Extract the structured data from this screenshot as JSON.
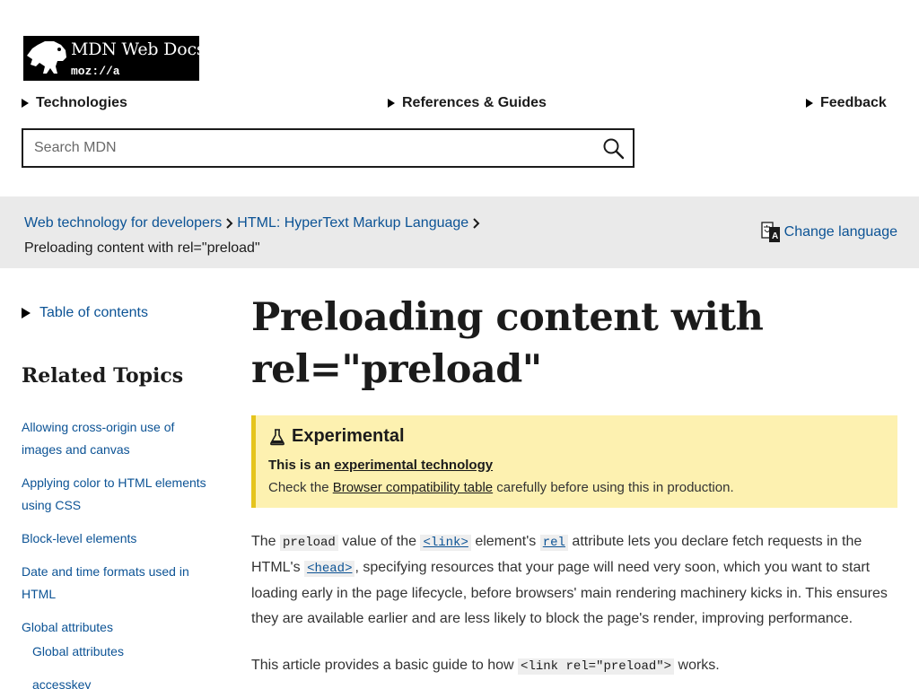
{
  "logo": {
    "title": "MDN Web Docs",
    "sub": "moz://a"
  },
  "nav": {
    "technologies": "Technologies",
    "references": "References & Guides",
    "feedback": "Feedback"
  },
  "search": {
    "placeholder": "Search MDN"
  },
  "breadcrumbs": {
    "items": [
      "Web technology for developers",
      "HTML: HyperText Markup Language"
    ],
    "current": "Preloading content with rel=\"preload\""
  },
  "language": {
    "label": "Change language"
  },
  "sidebar": {
    "toc": "Table of contents",
    "related": "Related Topics",
    "links": [
      "Allowing cross-origin use of images and canvas",
      "Applying color to HTML elements using CSS",
      "Block-level elements",
      "Date and time formats used in HTML",
      "Global attributes"
    ],
    "sub_links": [
      "Global attributes",
      "accesskey"
    ]
  },
  "article": {
    "title": "Preloading content with rel=\"preload\"",
    "notice": {
      "heading": "Experimental",
      "line1_prefix": "This is an ",
      "line1_link": "experimental technology",
      "line2_prefix": "Check the ",
      "line2_link": "Browser compatibility table",
      "line2_suffix": " carefully before using this in production."
    },
    "p1": {
      "t1": "The ",
      "c1": "preload",
      "t2": " value of the ",
      "c2": "<link>",
      "t3": " element's ",
      "c3": "rel",
      "t4": " attribute lets you declare fetch requests in the HTML's ",
      "c4": "<head>",
      "t5": ", specifying resources that your page will need very soon, which you want to start loading early in the page lifecycle, before browsers' main rendering machinery kicks in. This ensures they are available earlier and are less likely to block the page's render, improving performance."
    },
    "p2": {
      "t1": "This article provides a basic guide to how ",
      "c1": "<link rel=\"preload\">",
      "t2": " works."
    }
  }
}
